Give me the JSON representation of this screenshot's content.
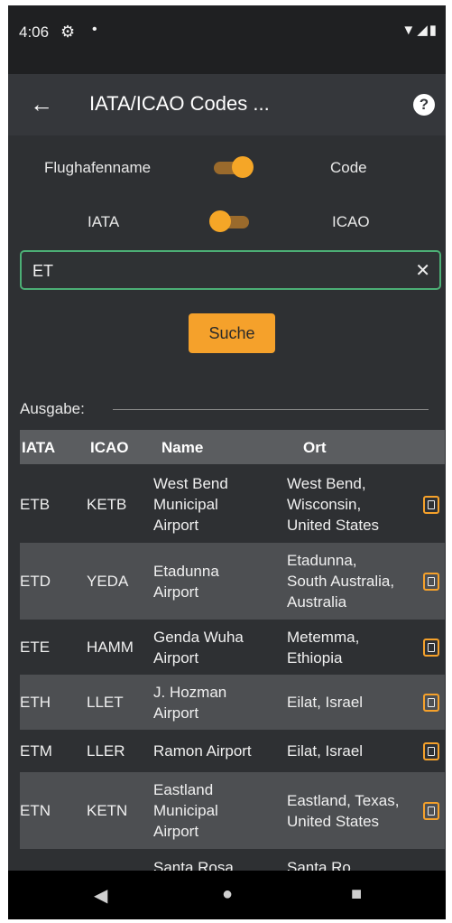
{
  "status": {
    "time": "4:06",
    "gear_icon": "⚙",
    "dot": "•",
    "right_icons": "▼◢▮"
  },
  "appbar": {
    "title": "IATA/ICAO Codes ...",
    "back_icon": "←",
    "help_icon": "?"
  },
  "toggles": {
    "left1": "Flughafenname",
    "right1": "Code",
    "switch1_on": true,
    "left2": "IATA",
    "right2": "ICAO",
    "switch2_on": false
  },
  "search": {
    "value": "ET",
    "clear_icon": "✕"
  },
  "button": {
    "label": "Suche"
  },
  "output": {
    "label": "Ausgabe:"
  },
  "table": {
    "headers": [
      "IATA",
      "ICAO",
      "Name",
      "Ort"
    ],
    "rows": [
      {
        "iata": "ETB",
        "icao": "KETB",
        "name": [
          "West Bend",
          "Municipal",
          "Airport"
        ],
        "ort": [
          "West Bend,",
          "Wisconsin,",
          "United States"
        ]
      },
      {
        "iata": "ETD",
        "icao": "YEDA",
        "name": [
          "Etadunna",
          "Airport"
        ],
        "ort": [
          "Etadunna,",
          "South Australia,",
          "Australia"
        ]
      },
      {
        "iata": "ETE",
        "icao": "HAMM",
        "name": [
          "Genda Wuha",
          "Airport"
        ],
        "ort": [
          "Metemma,",
          "Ethiopia"
        ]
      },
      {
        "iata": "ETH",
        "icao": "LLET",
        "name": [
          "J. Hozman",
          "Airport"
        ],
        "ort": [
          "Eilat, Israel"
        ]
      },
      {
        "iata": "ETM",
        "icao": "LLER",
        "name": [
          "Ramon Airport"
        ],
        "ort": [
          "Eilat, Israel"
        ]
      },
      {
        "iata": "ETN",
        "icao": "KETN",
        "name": [
          "Eastland",
          "Municipal",
          "Airport"
        ],
        "ort": [
          "Eastland, Texas,",
          "United States"
        ]
      },
      {
        "iata": "",
        "icao": "",
        "name": [
          "Santa Rosa"
        ],
        "ort": [
          "Santa Ro..."
        ]
      }
    ]
  },
  "nav": {
    "back": "◀",
    "home": "●",
    "recents": "■"
  }
}
